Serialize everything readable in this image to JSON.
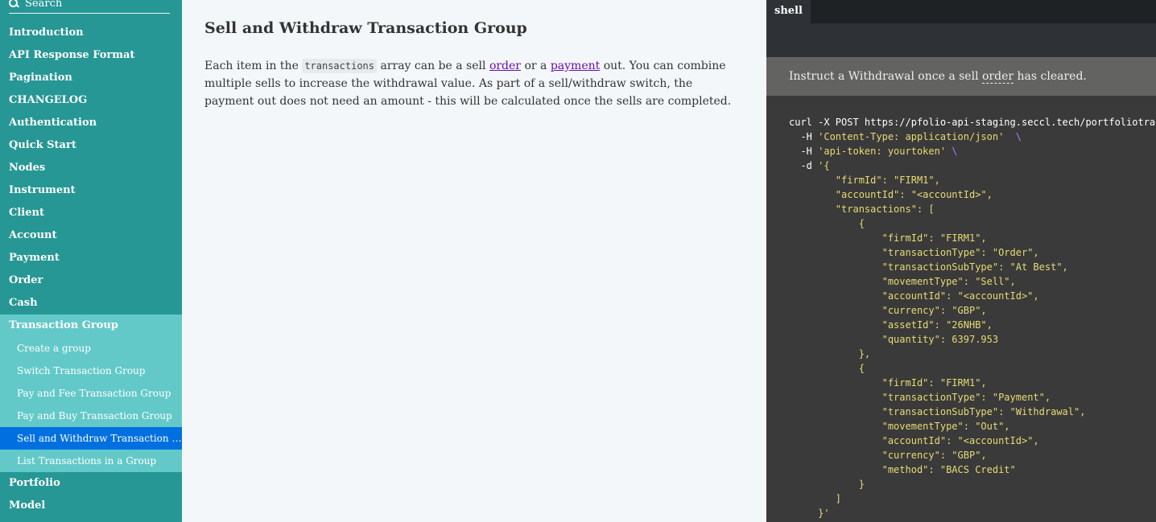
{
  "sidebar": {
    "search_placeholder": "Search",
    "items": [
      {
        "label": "Introduction"
      },
      {
        "label": "API Response Format"
      },
      {
        "label": "Pagination"
      },
      {
        "label": "CHANGELOG"
      },
      {
        "label": "Authentication"
      },
      {
        "label": "Quick Start"
      },
      {
        "label": "Nodes"
      },
      {
        "label": "Instrument"
      },
      {
        "label": "Client"
      },
      {
        "label": "Account"
      },
      {
        "label": "Payment"
      },
      {
        "label": "Order"
      },
      {
        "label": "Cash"
      }
    ],
    "group": {
      "label": "Transaction Group",
      "children": [
        {
          "label": "Create a group"
        },
        {
          "label": "Switch Transaction Group"
        },
        {
          "label": "Pay and Fee Transaction Group"
        },
        {
          "label": "Pay and Buy Transaction Group"
        },
        {
          "label": "Sell and Withdraw Transaction Group",
          "active": true
        },
        {
          "label": "List Transactions in a Group"
        }
      ]
    },
    "items_after": [
      {
        "label": "Portfolio"
      },
      {
        "label": "Model"
      }
    ]
  },
  "main": {
    "title": "Sell and Withdraw Transaction Group",
    "intro": {
      "t1": "Each item in the ",
      "code": "transactions",
      "t2": " array can be a sell ",
      "link1": "order",
      "t3": " or a ",
      "link2": "payment",
      "t4": " out. You can combine multiple sells to increase the withdrawal value. As part of a sell/withdraw switch, the payment out does not need an amount - this will be calculated once the sells are completed."
    }
  },
  "code_panel": {
    "tabs": [
      {
        "label": "shell",
        "active": true
      }
    ],
    "notice": {
      "t1": "Instruct a Withdrawal once a sell ",
      "abbr": "order",
      "t2": " has cleared."
    },
    "code_lines": [
      "curl -X POST https://pfolio-api-staging.seccl.tech/portfoliotransactiongroup",
      "  -H 'Content-Type: application/json'  \\",
      "  -H 'api-token: yourtoken' \\",
      "  -d '{",
      "        \"firmId\": \"FIRM1\",",
      "        \"accountId\": \"<accountId>\",",
      "        \"transactions\": [",
      "            {",
      "                \"firmId\": \"FIRM1\",",
      "                \"transactionType\": \"Order\",",
      "                \"transactionSubType\": \"At Best\",",
      "                \"movementType\": \"Sell\",",
      "                \"accountId\": \"<accountId>\",",
      "                \"currency\": \"GBP\",",
      "                \"assetId\": \"26NHB\",",
      "                \"quantity\": 6397.953",
      "            },",
      "            {",
      "                \"firmId\": \"FIRM1\",",
      "                \"transactionType\": \"Payment\",",
      "                \"transactionSubType\": \"Withdrawal\",",
      "                \"movementType\": \"Out\",",
      "                \"accountId\": \"<accountId>\",",
      "                \"currency\": \"GBP\",",
      "                \"method\": \"BACS Credit\"",
      "            }",
      "        ]",
      "     }'"
    ]
  }
}
